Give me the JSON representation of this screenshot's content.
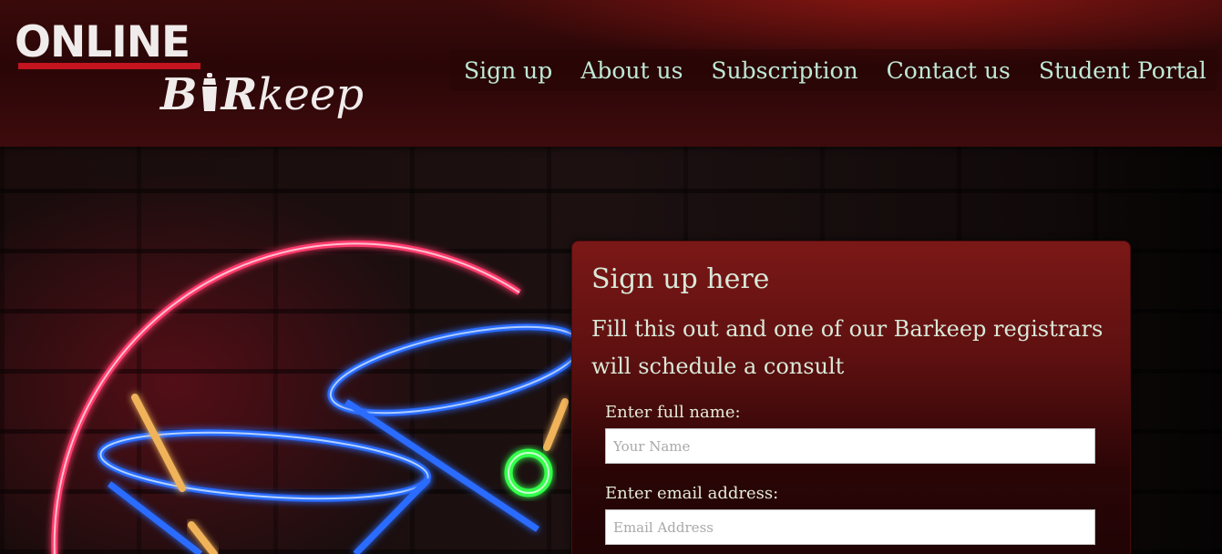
{
  "logo": {
    "line1": "ONLINE",
    "line2_start": "B",
    "line2_mid": "R",
    "line2_end": "keep"
  },
  "nav": {
    "items": [
      {
        "label": "Sign up"
      },
      {
        "label": "About us"
      },
      {
        "label": "Subscription"
      },
      {
        "label": "Contact us"
      },
      {
        "label": "Student Portal"
      }
    ]
  },
  "signup": {
    "title": "Sign up here",
    "subtitle": "Fill this out and one of our Barkeep registrars will schedule a consult",
    "name_label": "Enter full name:",
    "name_placeholder": "Your Name",
    "email_label": "Enter email address:",
    "email_placeholder": "Email Address"
  },
  "colors": {
    "nav_text": "#bfe8d6",
    "brand_red": "#c3141f",
    "card_top": "#7b1817"
  }
}
